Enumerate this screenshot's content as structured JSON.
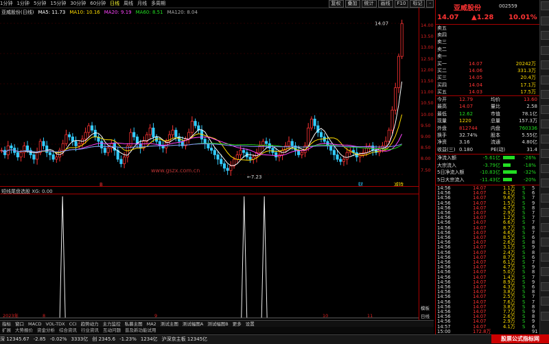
{
  "periods": [
    "1分钟",
    "1分钟",
    "5分钟",
    "15分钟",
    "30分钟",
    "60分钟",
    "日线",
    "周线",
    "月线",
    "多周期"
  ],
  "active_period": "日线",
  "tool_buttons": [
    "复权",
    "叠加",
    "统计",
    "画线",
    "F10",
    "标记",
    "-"
  ],
  "ma_line": {
    "name": "亚威股份(日线)",
    "items": [
      {
        "label": "MA5: 11.73",
        "color": "#ffffff"
      },
      {
        "label": "MA10: 10.16",
        "color": "#ffdd00"
      },
      {
        "label": "MA20: 9.19",
        "color": "#ff44ff"
      },
      {
        "label": "MA60: 8.51",
        "color": "#22dd22"
      },
      {
        "label": "MA120: 8.04",
        "color": "#aaaaaa"
      }
    ]
  },
  "price_ticks": [
    "14.00",
    "13.50",
    "13.00",
    "12.50",
    "12.00",
    "11.50",
    "11.00",
    "10.50",
    "10.00",
    "9.50",
    "9.00",
    "8.50",
    "8.00",
    "7.50"
  ],
  "high_label": "14.07",
  "low_label": "7.23",
  "indicator_title": "短线尾盘选股 XG: 0.00",
  "watermark": "www.gszx.com.cn",
  "markers": {
    "b1": "B",
    "mark2": "财",
    "mark3": "减持"
  },
  "bottom_tabs": [
    "指标",
    "窗口",
    "MACD",
    "VOL-TDX",
    "CCI",
    "趋势动力",
    "主力监控",
    "私募主图",
    "MA2",
    "测试主图",
    "测试幅图A",
    "测试幅图B",
    "更多",
    "设置"
  ],
  "bottom_tabs2": [
    "扩展",
    "大势报价",
    "资金分析",
    "综合资讯",
    "行业资讯",
    "互动问题",
    "普及新功能试用"
  ],
  "x_axis_labels": [
    "2023年",
    "8",
    "9",
    "10",
    "11"
  ],
  "right_bottom_labels": [
    "模板",
    "日线"
  ],
  "status": [
    "深 12345.67",
    "-2.85",
    "-0.02%",
    "3333亿",
    "创 2345.6",
    "-1.23%",
    "1234亿",
    "沪深京主板 12345亿"
  ],
  "stock": {
    "name": "亚威股份",
    "code": "002559",
    "price": "14.07",
    "change": "▲1.28",
    "pct": "10.01%"
  },
  "order_book": {
    "sell": [
      {
        "label": "卖五",
        "price": "",
        "vol": ""
      },
      {
        "label": "卖四",
        "price": "",
        "vol": ""
      },
      {
        "label": "卖三",
        "price": "",
        "vol": ""
      },
      {
        "label": "卖二",
        "price": "",
        "vol": ""
      },
      {
        "label": "卖一",
        "price": "",
        "vol": ""
      }
    ],
    "buy": [
      {
        "label": "买一",
        "price": "14.07",
        "vol": "20242万"
      },
      {
        "label": "买二",
        "price": "14.06",
        "vol": "331.3万"
      },
      {
        "label": "买三",
        "price": "14.05",
        "vol": "20.4万"
      },
      {
        "label": "买四",
        "price": "14.04",
        "vol": "17.1万"
      },
      {
        "label": "买五",
        "price": "14.03",
        "vol": "17.5万"
      }
    ]
  },
  "quote": [
    {
      "k1": "今开",
      "v1": "12.79",
      "k2": "均价",
      "v2": "13.60"
    },
    {
      "k1": "最高",
      "v1": "14.07",
      "k2": "量比",
      "v2": "2.58"
    },
    {
      "k1": "最低",
      "v1": "12.62",
      "k2": "市值",
      "v2": "78.1亿"
    },
    {
      "k1": "现量",
      "v1": "1220",
      "k2": "总量",
      "v2": "157.3万"
    },
    {
      "k1": "外盘",
      "v1": "812744",
      "k2": "内盘",
      "v2": "760336"
    },
    {
      "k1": "换手",
      "v1": "32.74%",
      "k2": "股本",
      "v2": "5.55亿"
    },
    {
      "k1": "净资",
      "v1": "3.16",
      "k2": "流通",
      "v2": "4.80亿"
    },
    {
      "k1": "收益(三)",
      "v1": "0.180",
      "k2": "PE(动)",
      "v2": "31.4"
    }
  ],
  "flows": [
    {
      "label": "净流入额",
      "value": "-5.61亿",
      "pct": "-26%",
      "bar": 0.55
    },
    {
      "label": "大宗流入",
      "value": "-3.79亿",
      "pct": "-18%",
      "bar": 0.38
    },
    {
      "label": "5日净流入额",
      "value": "-10.83亿",
      "pct": "-32%",
      "bar": 0.68
    },
    {
      "label": "5日大宗流入",
      "value": "-11.43亿",
      "pct": "-20%",
      "bar": 0.43
    }
  ],
  "ticks": [
    {
      "t": "14:56",
      "p": "14.07",
      "v": "1.1万",
      "d": "S",
      "n": "5"
    },
    {
      "t": "14:56",
      "p": "14.07",
      "v": "4.1万",
      "d": "S",
      "n": "6"
    },
    {
      "t": "14:56",
      "p": "14.07",
      "v": "9.6万",
      "d": "S",
      "n": "7"
    },
    {
      "t": "14:56",
      "p": "14.07",
      "v": "1.5万",
      "d": "S",
      "n": "9"
    },
    {
      "t": "14:56",
      "p": "14.07",
      "v": "4.7万",
      "d": "S",
      "n": "8"
    },
    {
      "t": "14:56",
      "p": "14.07",
      "v": "2.9万",
      "d": "S",
      "n": "7"
    },
    {
      "t": "14:56",
      "p": "14.07",
      "v": "1.2万",
      "d": "S",
      "n": "7"
    },
    {
      "t": "14:56",
      "p": "14.07",
      "v": "6.6万",
      "d": "S",
      "n": "7"
    },
    {
      "t": "14:56",
      "p": "14.07",
      "v": "8.7万",
      "d": "S",
      "n": "8"
    },
    {
      "t": "14:56",
      "p": "14.07",
      "v": "4.6万",
      "d": "S",
      "n": "7"
    },
    {
      "t": "14:56",
      "p": "14.07",
      "v": "8.5万",
      "d": "S",
      "n": "6"
    },
    {
      "t": "14:56",
      "p": "14.07",
      "v": "2.6万",
      "d": "S",
      "n": "8"
    },
    {
      "t": "14:56",
      "p": "14.07",
      "v": "3.1万",
      "d": "S",
      "n": "9"
    },
    {
      "t": "14:56",
      "p": "14.07",
      "v": "2.4万",
      "d": "S",
      "n": "8"
    },
    {
      "t": "14:56",
      "p": "14.07",
      "v": "8.7万",
      "d": "S",
      "n": "6"
    },
    {
      "t": "14:56",
      "p": "14.07",
      "v": "6.1万",
      "d": "S",
      "n": "7"
    },
    {
      "t": "14:56",
      "p": "14.07",
      "v": "4.7万",
      "d": "S",
      "n": "9"
    },
    {
      "t": "14:56",
      "p": "14.07",
      "v": "5.0万",
      "d": "S",
      "n": "8"
    },
    {
      "t": "14:56",
      "p": "14.07",
      "v": "1.4万",
      "d": "S",
      "n": "7"
    },
    {
      "t": "14:56",
      "p": "14.07",
      "v": "8.9万",
      "d": "S",
      "n": "9"
    },
    {
      "t": "14:56",
      "p": "14.07",
      "v": "4.3万",
      "d": "S",
      "n": "6"
    },
    {
      "t": "14:56",
      "p": "14.07",
      "v": "3.8万",
      "d": "S",
      "n": "8"
    },
    {
      "t": "14:56",
      "p": "14.07",
      "v": "2.5万",
      "d": "S",
      "n": "7"
    },
    {
      "t": "14:56",
      "p": "14.07",
      "v": "7.6万",
      "d": "S",
      "n": "7"
    },
    {
      "t": "14:56",
      "p": "14.07",
      "v": "3.8万",
      "d": "S",
      "n": "8"
    },
    {
      "t": "14:56",
      "p": "14.07",
      "v": "7.7万",
      "d": "S",
      "n": "9"
    },
    {
      "t": "14:56",
      "p": "14.07",
      "v": "2.6万",
      "d": "S",
      "n": "8"
    },
    {
      "t": "14:56",
      "p": "14.07",
      "v": "2.9万",
      "d": "S",
      "n": "9"
    },
    {
      "t": "14:57",
      "p": "14.07",
      "v": "4.1万",
      "d": "S",
      "n": "6"
    },
    {
      "t": "15:00",
      "p": "172.8万",
      "v": "",
      "d": "",
      "n": "91"
    }
  ],
  "brand": "股票公式指标网",
  "chart_data": {
    "type": "candlestick",
    "title": "亚威股份(日线)",
    "ylim": [
      7.2,
      14.2
    ],
    "x_labels": [
      "8",
      "9",
      "10",
      "11"
    ],
    "close": [
      8.4,
      8.2,
      8.6,
      8.5,
      8.3,
      8.1,
      8.3,
      8.6,
      8.4,
      8.2,
      8.0,
      8.3,
      8.8,
      8.6,
      8.3,
      8.2,
      8.0,
      8.1,
      8.4,
      8.7,
      9.1,
      9.0,
      8.8,
      8.6,
      8.7,
      8.9,
      9.2,
      9.5,
      9.3,
      9.0,
      8.8,
      8.5,
      8.3,
      8.5,
      8.7,
      8.4,
      8.0,
      7.8,
      8.1,
      8.6,
      9.2,
      9.0,
      8.7,
      8.5,
      8.8,
      9.1,
      9.4,
      9.0,
      8.8,
      8.6,
      8.5,
      8.8,
      9.1,
      9.3,
      9.0,
      8.8,
      8.6,
      8.9,
      9.2,
      9.7,
      9.5,
      9.3,
      8.9,
      8.7,
      8.5,
      8.4,
      8.2,
      8.0,
      7.8,
      7.6,
      7.5,
      7.7,
      8.0,
      8.2,
      8.4,
      8.3,
      8.1,
      8.0,
      8.1,
      8.3,
      8.6,
      8.8,
      8.7,
      8.5,
      8.3,
      8.1,
      8.2,
      8.4,
      8.6,
      8.8,
      8.6,
      8.4,
      8.2,
      8.3,
      8.6,
      9.4,
      9.8,
      9.5,
      9.2,
      9.0,
      8.8,
      8.6,
      8.4,
      8.2,
      8.0,
      7.9,
      8.0,
      8.3,
      8.4,
      8.3,
      8.1,
      8.2,
      8.3,
      8.5,
      8.6,
      8.4,
      8.3,
      8.5,
      8.6,
      8.8,
      9.3,
      10.2,
      11.2,
      12.6,
      14.07
    ],
    "pulses_x_fraction": [
      0.155,
      0.605,
      0.655
    ],
    "indicator": "短线尾盘选股 XG"
  }
}
